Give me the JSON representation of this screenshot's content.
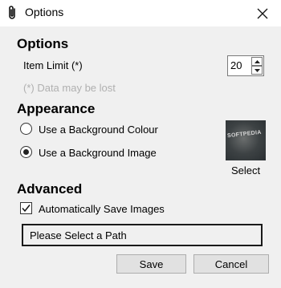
{
  "window": {
    "title": "Options",
    "icon": "paperclip-icon"
  },
  "options": {
    "heading": "Options",
    "item_limit_label": "Item Limit (*)",
    "item_limit_value": "20",
    "warning": "(*) Data may be lost"
  },
  "appearance": {
    "heading": "Appearance",
    "radio_colour": "Use a Background Colour",
    "radio_image": "Use a Background Image",
    "selected": "Use a Background Image",
    "select_label": "Select",
    "thumbnail_text": "SOFTPEDIA"
  },
  "advanced": {
    "heading": "Advanced",
    "auto_save_label": "Automatically Save Images",
    "auto_save_checked": true,
    "path_text": "Please Select a Path"
  },
  "buttons": {
    "save": "Save",
    "cancel": "Cancel"
  }
}
